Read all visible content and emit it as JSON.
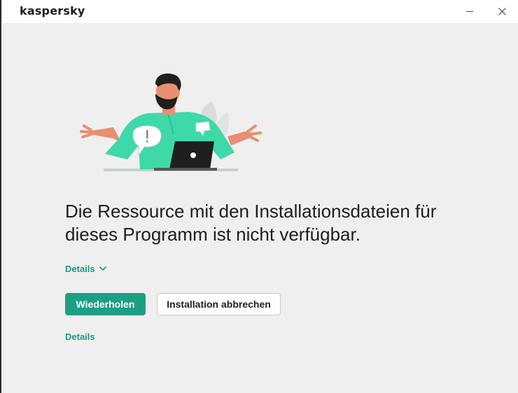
{
  "app": {
    "logo_text": "kaspersky"
  },
  "window_controls": {
    "minimize_icon": "minimize-icon",
    "close_icon": "close-icon"
  },
  "main": {
    "headline": "Die Ressource mit den Installationsdateien für dieses Programm ist nicht verfügbar.",
    "details_toggle_label": "Details",
    "retry_button": "Wiederholen",
    "cancel_button": "Installation abbrechen",
    "details_link": "Details"
  },
  "colors": {
    "accent": "#1e9e82",
    "link": "#1a9a80",
    "background": "#efefef"
  }
}
